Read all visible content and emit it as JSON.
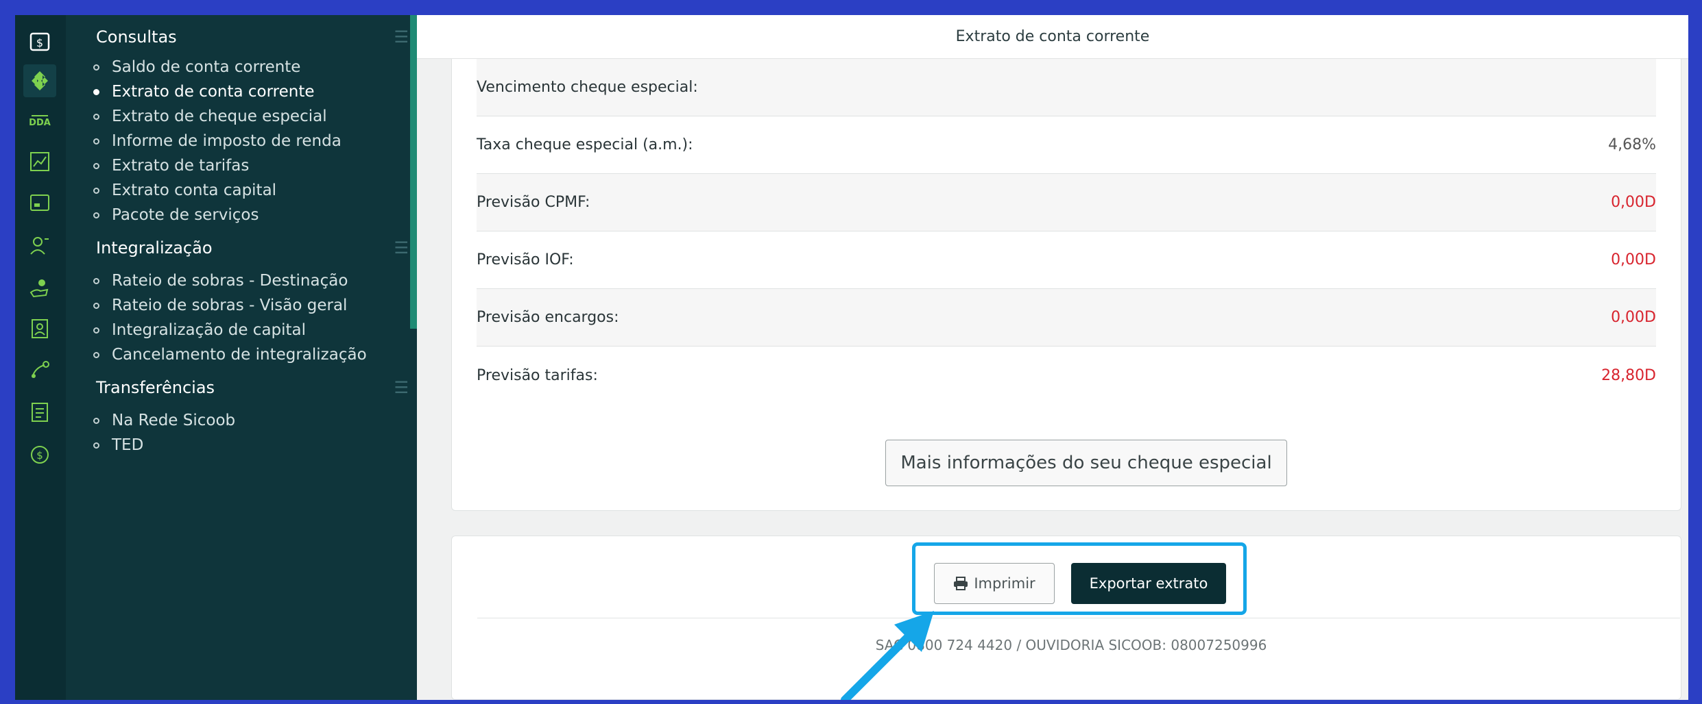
{
  "rail": {
    "icons": [
      "cash-icon",
      "clover-icon",
      "dda-icon",
      "chart-icon",
      "card-icon",
      "user-id-icon",
      "hand-coins-icon",
      "contact-icon",
      "transfer-icon",
      "document-icon",
      "coin-icon"
    ]
  },
  "menu": {
    "groups": [
      {
        "title": "Consultas",
        "items": [
          "Saldo de conta corrente",
          "Extrato de conta corrente",
          "Extrato de cheque especial",
          "Informe de imposto de renda",
          "Extrato de tarifas",
          "Extrato conta capital",
          "Pacote de serviços"
        ],
        "active_index": 1
      },
      {
        "title": "Integralização",
        "items": [
          "Rateio de sobras - Destinação",
          "Rateio de sobras - Visão geral",
          "Integralização de capital",
          "Cancelamento de integralização"
        ]
      },
      {
        "title": "Transferências",
        "items": [
          "Na Rede Sicoob",
          "TED"
        ]
      }
    ]
  },
  "header": {
    "title": "Extrato de conta corrente"
  },
  "details": {
    "rows": [
      {
        "label": "Vencimento cheque especial:",
        "value": ""
      },
      {
        "label": "Taxa cheque especial (a.m.):",
        "value": "4,68%"
      },
      {
        "label": "Previsão CPMF:",
        "value": "0,00D"
      },
      {
        "label": "Previsão IOF:",
        "value": "0,00D"
      },
      {
        "label": "Previsão encargos:",
        "value": "0,00D"
      },
      {
        "label": "Previsão tarifas:",
        "value": "28,80D"
      }
    ],
    "more_button": "Mais informações do seu cheque especial"
  },
  "actions": {
    "print_label": "Imprimir",
    "export_label": "Exportar extrato"
  },
  "footer": {
    "contact": "SAC 0800 724 4420 / OUVIDORIA SICOOB: 08007250996"
  },
  "colors": {
    "negative": "#d8242e",
    "highlight": "#15a6e8",
    "accent": "#7ed14f",
    "sidebar": "#0f353b"
  }
}
